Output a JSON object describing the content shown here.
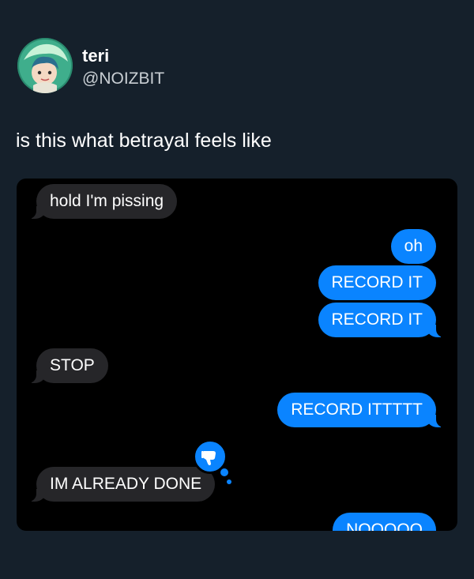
{
  "tweet": {
    "author_name": "teri",
    "author_handle": "@NOIZBIT",
    "text": "is this what betrayal feels like"
  },
  "messages": [
    {
      "side": "received",
      "text": "hold I'm pissing"
    },
    {
      "side": "sent",
      "text": "oh"
    },
    {
      "side": "sent",
      "text": "RECORD IT"
    },
    {
      "side": "sent",
      "text": "RECORD IT"
    },
    {
      "side": "received",
      "text": "STOP"
    },
    {
      "side": "sent",
      "text": "RECORD ITTTTT"
    },
    {
      "side": "received",
      "text": "IM ALREADY DONE",
      "reaction": "thumbs-down"
    },
    {
      "side": "sent",
      "text": "NOOOOO"
    }
  ],
  "colors": {
    "background": "#15202b",
    "sent_bubble": "#0a84ff",
    "received_bubble": "#262629"
  }
}
